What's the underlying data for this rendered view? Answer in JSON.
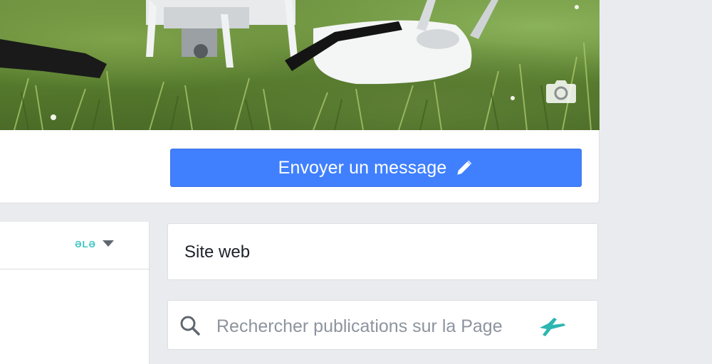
{
  "cover": {
    "photo_description": "",
    "camera_icon": "camera-icon"
  },
  "actions": {
    "send_message_label": "Envoyer un message",
    "send_message_icon": "pencil-icon"
  },
  "left_panel": {
    "badge_text": "ƏLƏ",
    "dropdown_icon": "caret-down-icon"
  },
  "sidebar": {
    "website_label": "Site web",
    "search_placeholder": "Rechercher publications sur la Page",
    "search_icon": "magnifier-icon",
    "brand_icon": "brand-mark-icon"
  },
  "colors": {
    "primary_button": "#4080ff",
    "background": "#e9ebee",
    "card": "#ffffff",
    "brand_teal": "#3cc6c0"
  }
}
